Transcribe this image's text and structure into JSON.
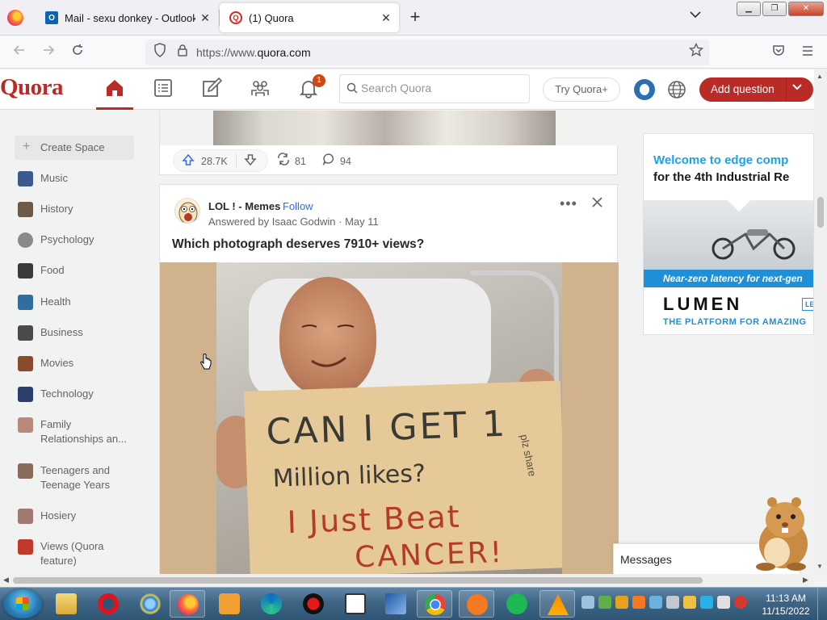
{
  "browser": {
    "tabs": [
      {
        "title": "Mail - sexu donkey - Outlook",
        "active": false
      },
      {
        "title": "(1) Quora",
        "active": true
      }
    ],
    "url_prefix": "https://www.",
    "url_domain": "quora.com",
    "win_min": "▁",
    "win_max": "❐",
    "win_close": "✕"
  },
  "header": {
    "logo": "Quora",
    "notification_count": "1",
    "search_placeholder": "Search Quora",
    "try_plus": "Try Quora+",
    "add_question": "Add question"
  },
  "sidebar": {
    "create_space": "Create Space",
    "items": [
      {
        "label": "Music",
        "color": "#3c5a8c"
      },
      {
        "label": "History",
        "color": "#6e5a48"
      },
      {
        "label": "Psychology",
        "color": "#8a8a8a"
      },
      {
        "label": "Food",
        "color": "#3a3a3a"
      },
      {
        "label": "Health",
        "color": "#2f6e9e"
      },
      {
        "label": "Business",
        "color": "#4a4a4a"
      },
      {
        "label": "Movies",
        "color": "#8a4a2e"
      },
      {
        "label": "Technology",
        "color": "#2a3f6e"
      },
      {
        "label": "Family Relationships an...",
        "color": "#b88a7a"
      },
      {
        "label": "Teenagers and Teenage Years",
        "color": "#8a6a5a"
      },
      {
        "label": "Hosiery",
        "color": "#a07a70"
      },
      {
        "label": "Views (Quora feature)",
        "color": "#c0392b"
      }
    ]
  },
  "feed": {
    "prev_post": {
      "upvotes": "28.7K",
      "shares": "81",
      "comments": "94"
    },
    "post": {
      "space": "LOL ! - Memes",
      "follow": "Follow",
      "meta": "Answered by Isaac Godwin · May 11",
      "question": "Which photograph deserves 7910+ views?",
      "sign_lines": [
        "CAN I GET 1",
        "Million likes?",
        "I Just Beat",
        "CANCER!"
      ],
      "sign_side": "plz share"
    }
  },
  "ad": {
    "headline_1": "Welcome to edge comp",
    "headline_2": "for the 4th Industrial Re",
    "band": "Near-zero latency for next-gen",
    "brand": "LUMEN",
    "brand_tag": "LE",
    "tagline": "THE PLATFORM FOR AMAZING"
  },
  "messages": {
    "label": "Messages"
  },
  "taskbar": {
    "time": "11:13 AM",
    "date": "11/15/2022"
  }
}
